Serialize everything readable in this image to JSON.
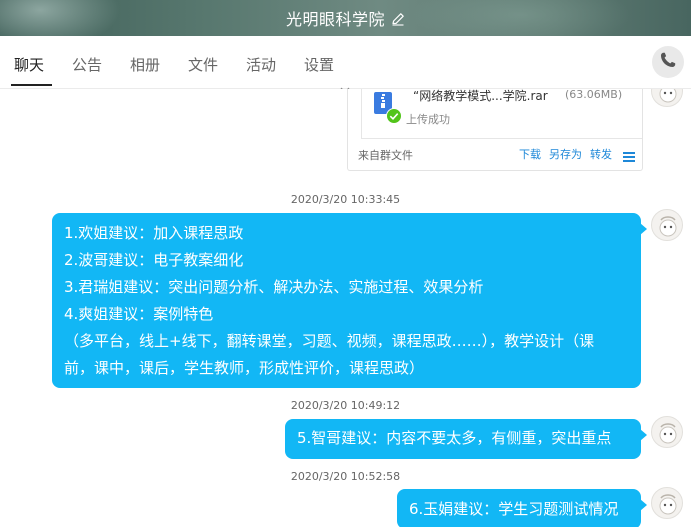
{
  "header": {
    "title": "光明眼科学院",
    "edit_icon": "pencil-edit-icon",
    "colors": {
      "background": "#58786f",
      "text": "#ffffff"
    }
  },
  "tabs": [
    {
      "label": "聊天",
      "active": true
    },
    {
      "label": "公告",
      "active": false
    },
    {
      "label": "相册",
      "active": false
    },
    {
      "label": "文件",
      "active": false
    },
    {
      "label": "活动",
      "active": false
    },
    {
      "label": "设置",
      "active": false,
      "has_dropdown": true
    }
  ],
  "toolbar": {
    "call_icon": "phone-icon"
  },
  "file_message": {
    "file_name": "“网络教学模式...学院.rar",
    "file_size": "(63.06MB)",
    "status": "上传成功",
    "source": "来自群文件",
    "actions": [
      "下载",
      "另存为",
      "转发"
    ],
    "menu_icon": "menu-icon",
    "file_icon": "archive-file-icon",
    "status_icon": "check-circle-icon"
  },
  "messages": [
    {
      "time": "2020/3/20 10:33:45",
      "lines": [
        "1.欢姐建议：加入课程思政",
        "2.波哥建议：电子教案细化",
        "3.君瑞姐建议：突出问题分析、解决办法、实施过程、效果分析",
        "4.爽姐建议：案例特色",
        "（多平台，线上+线下，翻转课堂，习题、视频，课程思政……），教学设计（课",
        "前，课中，课后，学生教师，形成性评价，课程思政）"
      ]
    },
    {
      "time": "2020/3/20 10:49:12",
      "lines": [
        "5.智哥建议：内容不要太多，有侧重，突出重点"
      ]
    },
    {
      "time": "2020/3/20 10:52:58",
      "lines": [
        "6.玉娟建议：学生习题测试情况"
      ]
    }
  ],
  "colors": {
    "bubble": "#12b7f5",
    "link": "#1e88d8",
    "status_ok": "#52c41a"
  }
}
